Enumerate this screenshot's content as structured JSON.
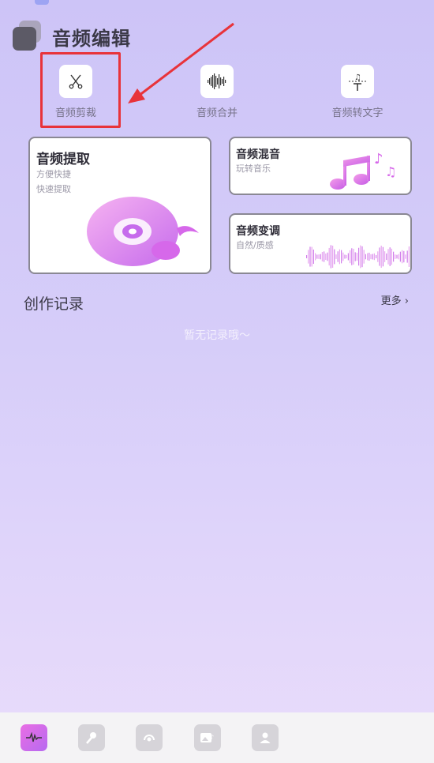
{
  "app": {
    "title": "音频编辑"
  },
  "tools": [
    {
      "label": "音频剪裁",
      "icon": "scissors-icon"
    },
    {
      "label": "音频合并",
      "icon": "waveform-icon"
    },
    {
      "label": "音频转文字",
      "icon": "text-music-icon"
    }
  ],
  "cards": {
    "extract": {
      "title": "音频提取",
      "line1": "方便快捷",
      "line2": "快速提取",
      "icon": "vinyl-disc-icon"
    },
    "mix": {
      "title": "音频混音",
      "sub": "玩转音乐",
      "icon": "music-notes-icon"
    },
    "pitch": {
      "title": "音频变调",
      "sub": "自然/质感",
      "icon": "waveform-icon"
    }
  },
  "records": {
    "title": "创作记录",
    "more": "更多",
    "empty": "暂无记录哦～"
  },
  "tabbar": [
    {
      "icon": "audio-wave-icon",
      "active": true
    },
    {
      "icon": "microphone-icon",
      "active": false
    },
    {
      "icon": "earphone-icon",
      "active": false
    },
    {
      "icon": "image-music-icon",
      "active": false
    },
    {
      "icon": "user-icon",
      "active": false
    }
  ],
  "colors": {
    "highlight": "#e8333a",
    "accent": "#d668ea",
    "tab_active": "#c66bec"
  }
}
